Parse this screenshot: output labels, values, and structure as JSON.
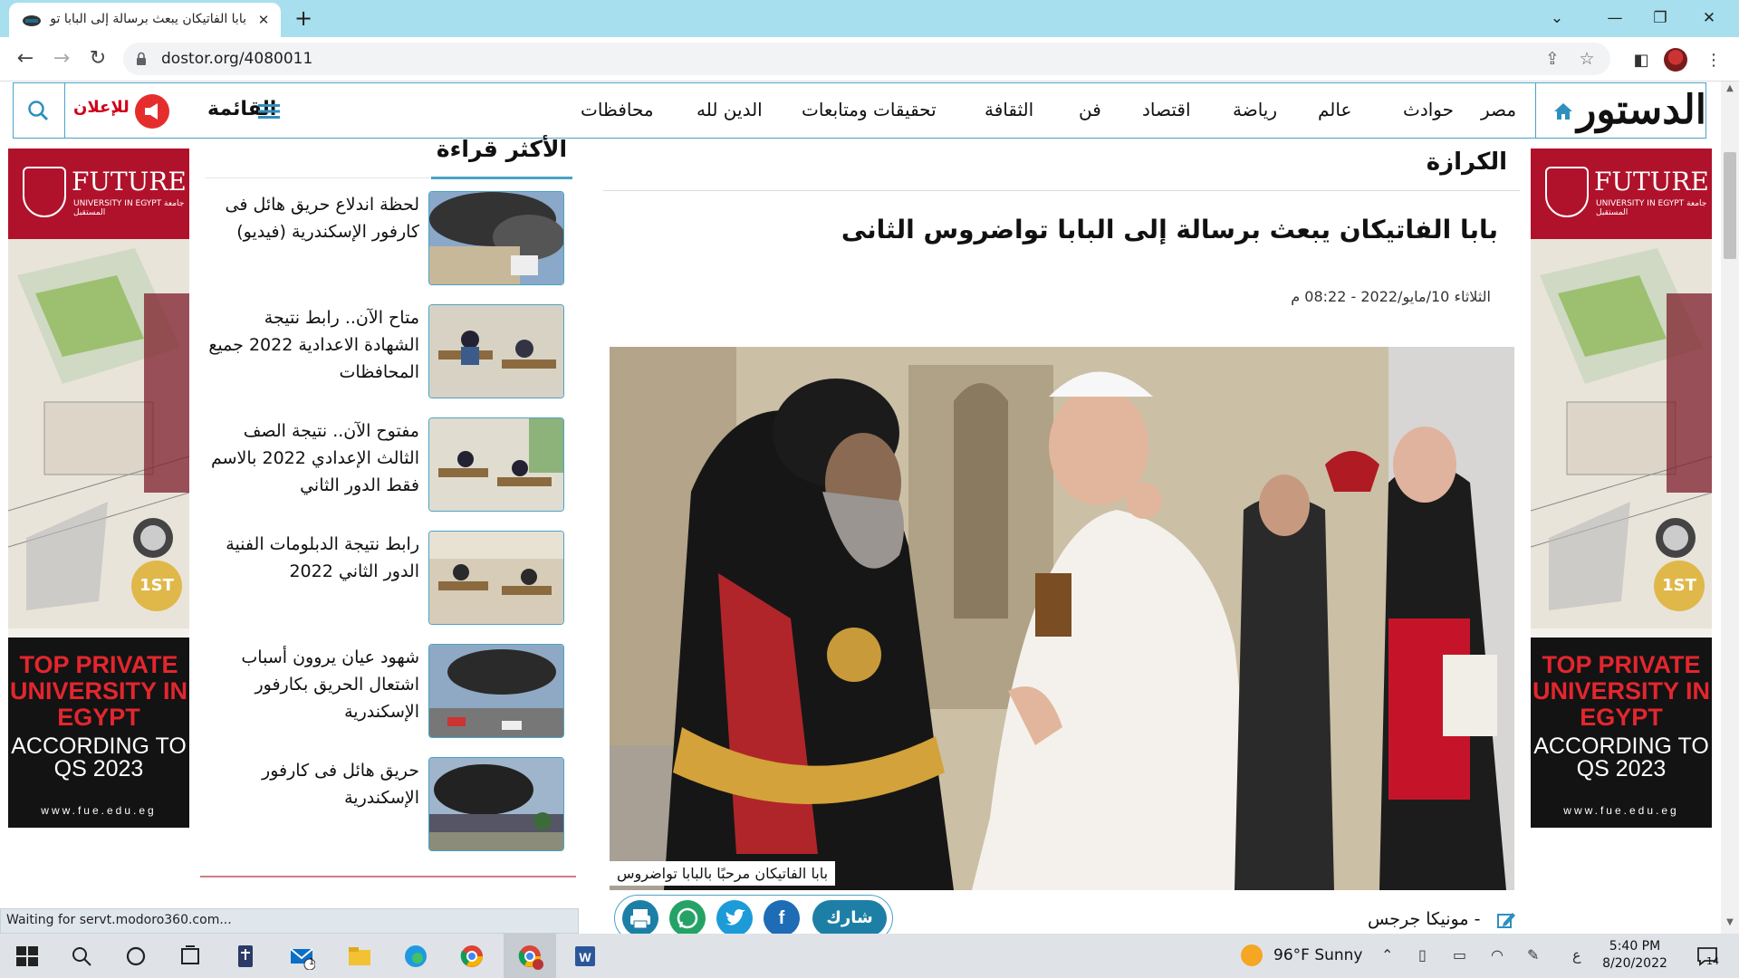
{
  "browser": {
    "tab_title": "بابا الفاتيكان يبعث برسالة إلى البابا تواضروس الثانى",
    "url": "dostor.org/4080011",
    "status": "Waiting for servt.modoro360.com..."
  },
  "site": {
    "logo": "الدستور",
    "nav": [
      "مصر",
      "حوادث",
      "عالم",
      "رياضة",
      "اقتصاد",
      "فن",
      "الثقافة",
      "تحقيقات ومتابعات",
      "الدين لله",
      "محافظات"
    ],
    "menu_label": "القائمة",
    "ad_label": "للإعلان"
  },
  "ad": {
    "brand": "FUTURE",
    "brand_sub": "UNIVERSITY IN EGYPT جامعة المستقبل",
    "badge": "1ST",
    "headline": "TOP PRIVATE UNIVERSITY IN EGYPT",
    "according": "ACCORDING TO QS 2023",
    "url": "www.fue.edu.eg"
  },
  "most_read": {
    "title": "الأكثر قراءة",
    "items": [
      "لحظة اندلاع حريق هائل فى كارفور الإسكندرية (فيديو)",
      "متاح الآن.. رابط نتيجة الشهادة الاعدادية 2022 جميع المحافظات",
      "مفتوح الآن.. نتيجة الصف الثالث الإعدادي 2022 بالاسم فقط الدور الثاني",
      "رابط نتيجة الدبلومات الفنية الدور الثاني 2022",
      "شهود عيان يروون أسباب اشتعال الحريق بكارفور الإسكندرية",
      "حريق هائل فى كارفور الإسكندرية"
    ]
  },
  "article": {
    "section": "الكرازة",
    "title": "بابا الفاتيكان يبعث برسالة إلى البابا تواضروس الثانى",
    "date": "الثلاثاء 10/مايو/2022 - 08:22 م",
    "caption": "بابا الفاتيكان مرحبًا بالبابا تواضروس",
    "author": "- مونيكا جرجس",
    "share_label": "شارك"
  },
  "taskbar": {
    "weather": "96°F  Sunny",
    "time": "5:40 PM",
    "date": "8/20/2022",
    "lang": "ع",
    "mail_badge": "1",
    "notify_count": "14"
  }
}
